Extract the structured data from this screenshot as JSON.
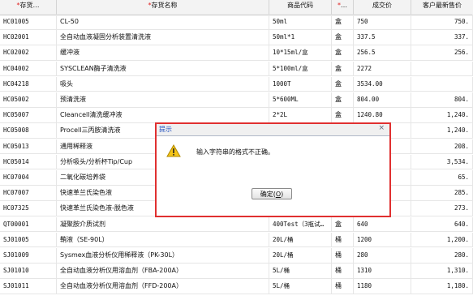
{
  "columns": {
    "code": {
      "star": "*",
      "label": "存货…"
    },
    "name": {
      "star": "*",
      "label": "存货名称"
    },
    "spec": {
      "label": "商品代码"
    },
    "unit": {
      "star": "*",
      "label": "…"
    },
    "price": {
      "label": "成交价"
    },
    "latest": {
      "label": "客户最新售价"
    }
  },
  "rows": [
    {
      "code": "HC01005",
      "name": "CL-50",
      "spec": "50ml",
      "unit": "盒",
      "price": "750",
      "latest": "750."
    },
    {
      "code": "HC02001",
      "name": "全自动血液凝固分析装置清洗液",
      "spec": "50ml*1",
      "unit": "盒",
      "price": "337.5",
      "latest": "337."
    },
    {
      "code": "HC02002",
      "name": "缓冲液",
      "spec": "10*15ml/盒",
      "unit": "盒",
      "price": "256.5",
      "latest": "256."
    },
    {
      "code": "HC04002",
      "name": "SYSCLEAN酶子清洗液",
      "spec": "5*100ml/盒",
      "unit": "盒",
      "price": "2272",
      "latest": ""
    },
    {
      "code": "HC04218",
      "name": "吸头",
      "spec": "1000T",
      "unit": "盒",
      "price": "3534.00",
      "latest": ""
    },
    {
      "code": "HC05002",
      "name": "预清洗液",
      "spec": "5*600ML",
      "unit": "盒",
      "price": "804.00",
      "latest": "804."
    },
    {
      "code": "HC05007",
      "name": "Cleancell清洗缓冲液",
      "spec": "2*2L",
      "unit": "盒",
      "price": "1240.80",
      "latest": "1,240."
    },
    {
      "code": "HC05008",
      "name": "Procell三丙胺清洗液",
      "spec": "",
      "unit": "",
      "price": "",
      "latest": "1,240."
    },
    {
      "code": "HC05013",
      "name": "通用稀释液",
      "spec": "",
      "unit": "",
      "price": "",
      "latest": "208."
    },
    {
      "code": "HC05014",
      "name": "分析吸头/分析杯Tip/Cup",
      "spec": "",
      "unit": "",
      "price": "",
      "latest": "3,534."
    },
    {
      "code": "HC07004",
      "name": "二氧化碳培养袋",
      "spec": "",
      "unit": "",
      "price": "",
      "latest": "65."
    },
    {
      "code": "HC07007",
      "name": "快速革兰氏染色液",
      "spec": "",
      "unit": "",
      "price": "",
      "latest": "285."
    },
    {
      "code": "HC07325",
      "name": "快速革兰氏染色液-脱色液",
      "spec": "",
      "unit": "",
      "price": "",
      "latest": "273."
    },
    {
      "code": "QT00001",
      "name": "凝聚胺介质试剂",
      "spec": "400Test（3瓶试…",
      "unit": "盒",
      "price": "640",
      "latest": "640."
    },
    {
      "code": "SJ01005",
      "name": "鞘液（SE-90L）",
      "spec": "20L/桶",
      "unit": "桶",
      "price": "1200",
      "latest": "1,200."
    },
    {
      "code": "SJ01009",
      "name": "Sysmex血液分析仪用稀释液（PK-30L）",
      "spec": "20L/桶",
      "unit": "桶",
      "price": "280",
      "latest": "280."
    },
    {
      "code": "SJ01010",
      "name": "全自动血液分析仪用溶血剂（FBA-200A）",
      "spec": "5L/桶",
      "unit": "桶",
      "price": "1310",
      "latest": "1,310."
    },
    {
      "code": "SJ01011",
      "name": "全自动血液分析仪用溶血剂（FFD-200A）",
      "spec": "5L/桶",
      "unit": "桶",
      "price": "1180",
      "latest": "1,180."
    }
  ],
  "dialog": {
    "title": "提示",
    "close": "×",
    "icon": "warning-icon",
    "message": "输入字符串的格式不正确。",
    "ok_label": "确定(",
    "ok_hotkey": "O",
    "ok_label_end": ")"
  },
  "colors": {
    "highlight_border": "#e03030",
    "required_star": "#e02020",
    "title_text": "#2050c0"
  }
}
